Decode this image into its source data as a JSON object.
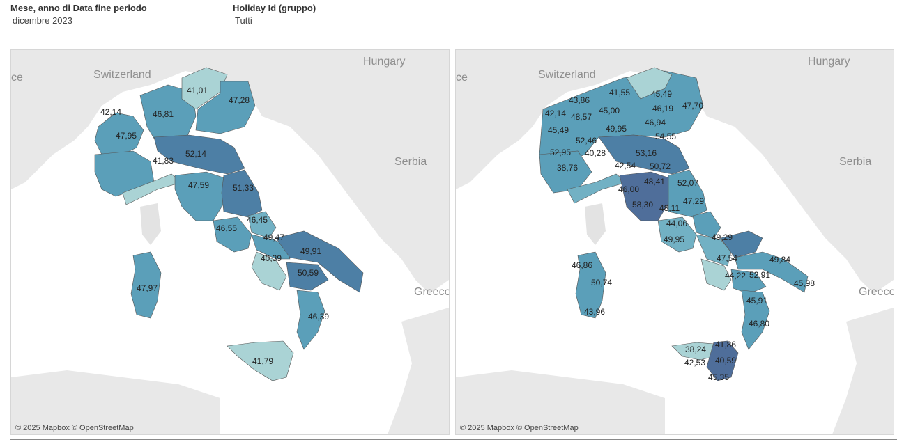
{
  "filters": {
    "month": {
      "title": "Mese, anno di Data fine periodo",
      "value": "dicembre 2023"
    },
    "holiday": {
      "title": "Holiday Id (gruppo)",
      "value": "Tutti"
    }
  },
  "colors": {
    "sea": "#ffffff",
    "land": "#e8e8e8",
    "light": "#aad3d5",
    "mid": "#72b1c4",
    "base": "#5b9fb9",
    "dark": "#4d7fa5",
    "darker": "#4f6e9a"
  },
  "maps": [
    {
      "countries": [
        "Switzerland",
        "Hungary",
        "Serbia",
        "Greece",
        "ce"
      ],
      "attribution": "© 2025 Mapbox © OpenStreetMap",
      "regions": [
        {
          "name": "Valle d'Aosta",
          "value": "42,14"
        },
        {
          "name": "Piemonte",
          "value": "47,95"
        },
        {
          "name": "Lombardia",
          "value": "46,81"
        },
        {
          "name": "Trentino-Alto Adige",
          "value": "41,01"
        },
        {
          "name": "Veneto/Friuli",
          "value": "47,28"
        },
        {
          "name": "Liguria",
          "value": "41,83"
        },
        {
          "name": "Emilia-Romagna",
          "value": "52,14"
        },
        {
          "name": "Toscana",
          "value": "47,59"
        },
        {
          "name": "Marche/Umbria",
          "value": "51,33"
        },
        {
          "name": "Abruzzo",
          "value": "46,45"
        },
        {
          "name": "Lazio",
          "value": "46,55"
        },
        {
          "name": "Molise",
          "value": "49,47"
        },
        {
          "name": "Puglia",
          "value": "49,91"
        },
        {
          "name": "Campania",
          "value": "40,39"
        },
        {
          "name": "Basilicata",
          "value": "50,59"
        },
        {
          "name": "Calabria",
          "value": "46,39"
        },
        {
          "name": "Sicilia",
          "value": "41,79"
        },
        {
          "name": "Sardegna",
          "value": "47,97"
        }
      ]
    },
    {
      "countries": [
        "Switzerland",
        "Hungary",
        "Serbia",
        "Greece",
        "ce"
      ],
      "attribution": "© 2025 Mapbox © OpenStreetMap",
      "provinces": [
        "43,86",
        "41,55",
        "45,49",
        "42,14",
        "48,57",
        "45,00",
        "46,19",
        "47,70",
        "45,49",
        "46,94",
        "49,95",
        "52,46",
        "54,55",
        "52,95",
        "40,28",
        "53,16",
        "38,76",
        "42,54",
        "50,72",
        "52,07",
        "48,41",
        "46,00",
        "58,30",
        "48,11",
        "47,29",
        "44,06",
        "49,95",
        "49,29",
        "47,54",
        "49,84",
        "44,22",
        "52,91",
        "45,98",
        "46,86",
        "50,74",
        "43,96",
        "45,91",
        "46,80",
        "38,24",
        "41,86",
        "42,53",
        "40,59",
        "45,35"
      ]
    }
  ]
}
